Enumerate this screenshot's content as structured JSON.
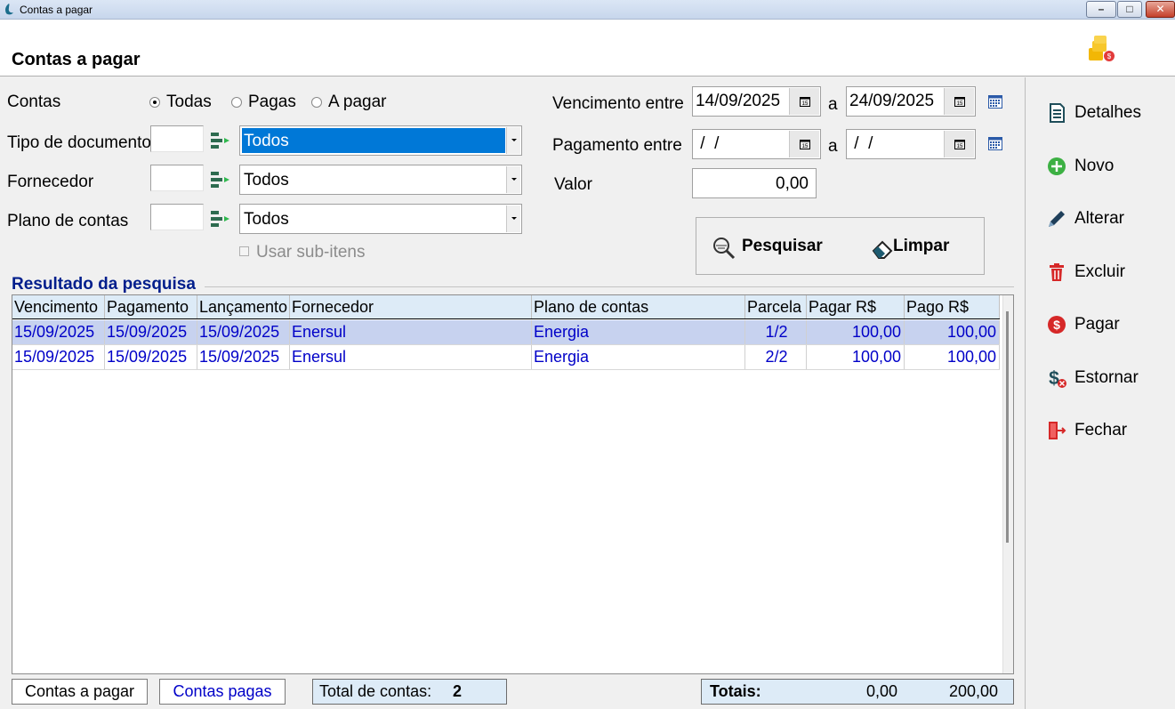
{
  "window": {
    "title": "Contas a pagar"
  },
  "header": {
    "title": "Contas a pagar",
    "icon": "coins-icon"
  },
  "filters": {
    "contas_label": "Contas",
    "radio_options": [
      "Todas",
      "Pagas",
      "A pagar"
    ],
    "radio_selected": "Todas",
    "tipo_documento": {
      "label": "Tipo de documento",
      "code": "",
      "value": "Todos"
    },
    "fornecedor": {
      "label": "Fornecedor",
      "code": "",
      "value": "Todos"
    },
    "plano_contas": {
      "label": "Plano de contas",
      "code": "",
      "value": "Todos"
    },
    "sub_itens_label": "Usar sub-itens",
    "vencimento": {
      "label": "Vencimento entre",
      "from": "14/09/2025",
      "sep": "a",
      "to": "24/09/2025"
    },
    "pagamento": {
      "label": "Pagamento entre",
      "from": " /  /",
      "sep": "a",
      "to": " /  /"
    },
    "valor": {
      "label": "Valor",
      "value": "0,00"
    },
    "search_label": "Pesquisar",
    "clear_label": "Limpar"
  },
  "results": {
    "title": "Resultado da pesquisa",
    "columns": [
      "Vencimento",
      "Pagamento",
      "Lançamento",
      "Fornecedor",
      "Plano de contas",
      "Parcela",
      "Pagar R$",
      "Pago R$"
    ],
    "rows": [
      [
        "15/09/2025",
        "15/09/2025",
        "15/09/2025",
        "Enersul",
        "Energia",
        "1/2",
        "100,00",
        "100,00"
      ],
      [
        "15/09/2025",
        "15/09/2025",
        "15/09/2025",
        "Enersul",
        "Energia",
        "2/2",
        "100,00",
        "100,00"
      ]
    ]
  },
  "sidebar": {
    "items": [
      {
        "label": "Detalhes",
        "icon": "document-icon"
      },
      {
        "label": "Novo",
        "icon": "plus-circle-icon"
      },
      {
        "label": "Alterar",
        "icon": "pencil-icon"
      },
      {
        "label": "Excluir",
        "icon": "trash-icon"
      },
      {
        "label": "Pagar",
        "icon": "dollar-circle-icon"
      },
      {
        "label": "Estornar",
        "icon": "dollar-cancel-icon"
      },
      {
        "label": "Fechar",
        "icon": "exit-door-icon"
      }
    ]
  },
  "footer": {
    "tab_contas_a_pagar": "Contas a pagar",
    "tab_contas_pagas": "Contas pagas",
    "total_label": "Total de contas:",
    "total_value": "2",
    "totais_label": "Totais:",
    "totais_pagar": "0,00",
    "totais_pago": "200,00"
  },
  "colors": {
    "accent": "#0078d7",
    "grid_text": "#0000c8",
    "results_title": "#001e8c",
    "selected_row": "#c7d2ef",
    "header_bg": "#ddebf7"
  }
}
